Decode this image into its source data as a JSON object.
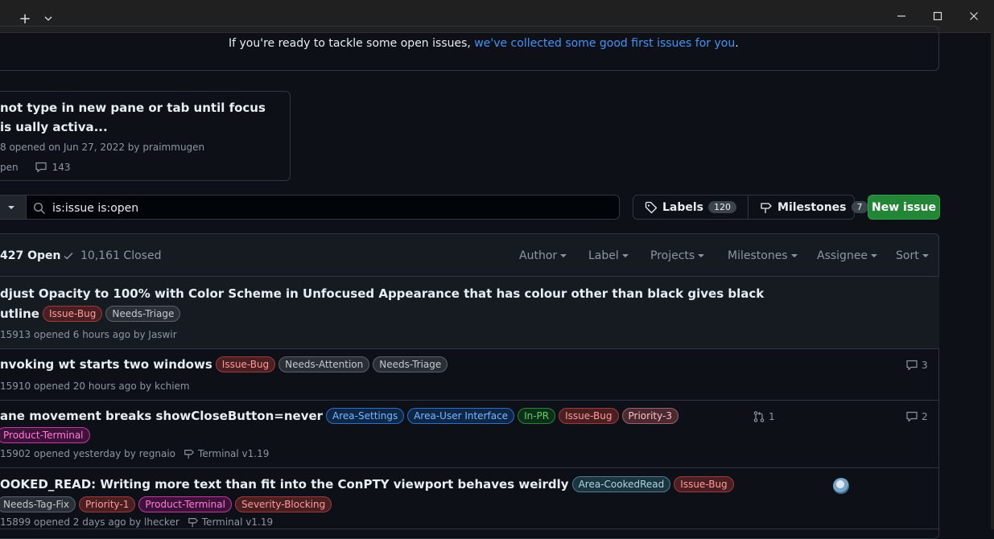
{
  "window": {
    "new_tab": "+",
    "colors": {
      "titlebar": "#202020",
      "accent": "#4493f8",
      "primary_button": "#238636"
    }
  },
  "banner": {
    "text": "If you're ready to tackle some open issues, ",
    "link": "we've collected some good first issues for you",
    "end": "."
  },
  "pinned": {
    "title": "not type in new pane or tab until focus is ually activa...",
    "meta": "8 opened on Jun 27, 2022 by praimmugen",
    "state": "pen",
    "comments": "143"
  },
  "filter": {
    "dropdown": "",
    "search_value": "is:issue is:open"
  },
  "labels_btn": {
    "label": "Labels",
    "count": "120"
  },
  "milestones_btn": {
    "label": "Milestones",
    "count": "7"
  },
  "new_issue": "New issue",
  "header": {
    "open": "427 Open",
    "closed": "10,161 Closed",
    "filters": [
      "Author",
      "Label",
      "Projects",
      "Milestones",
      "Assignee",
      "Sort"
    ]
  },
  "issues": [
    {
      "title_line1": "djust Opacity to 100% with Color Scheme in Unfocused Appearance that has colour other than black gives black",
      "title_line2": "utline",
      "labels": [
        "Issue-Bug",
        "Needs-Triage"
      ],
      "meta": "15913 opened 6 hours ago by Jaswir"
    },
    {
      "title": "nvoking wt starts two windows",
      "labels": [
        "Issue-Bug",
        "Needs-Attention",
        "Needs-Triage"
      ],
      "meta": "15910 opened 20 hours ago by kchiem",
      "comments": "3"
    },
    {
      "title": "ane movement breaks showCloseButton=never",
      "labels": [
        "Area-Settings",
        "Area-User Interface",
        "In-PR",
        "Issue-Bug",
        "Priority-3"
      ],
      "labels_line2": [
        "Product-Terminal"
      ],
      "meta": "15902 opened yesterday by regnaio",
      "milestone": "Terminal v1.19",
      "prs": "1",
      "comments": "2"
    },
    {
      "title": "OOKED_READ: Writing more text than fit into the ConPTY viewport behaves weirdly",
      "labels": [
        "Area-CookedRead",
        "Issue-Bug"
      ],
      "labels_line2": [
        "Needs-Tag-Fix",
        "Priority-1",
        "Product-Terminal",
        "Severity-Blocking"
      ],
      "meta": "15899 opened 2 days ago by lhecker",
      "milestone": "Terminal v1.19"
    }
  ]
}
